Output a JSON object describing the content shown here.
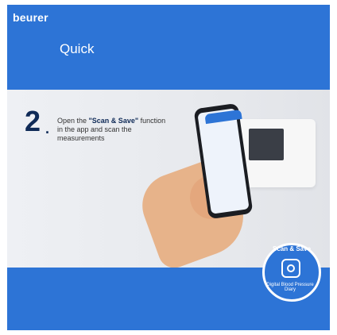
{
  "brand": {
    "name": "beurer"
  },
  "header": {
    "title": "Quick"
  },
  "step": {
    "number": "2",
    "text_prefix": "Open the ",
    "text_highlight": "\"Scan & Save\"",
    "text_suffix": " function in the app and scan the measurements"
  },
  "badge": {
    "top_text": "Scan & Save",
    "bottom_text": "Digital Blood Pressure Diary"
  },
  "colors": {
    "brand_blue": "#2d74d6",
    "dark_navy": "#0f2a57"
  }
}
